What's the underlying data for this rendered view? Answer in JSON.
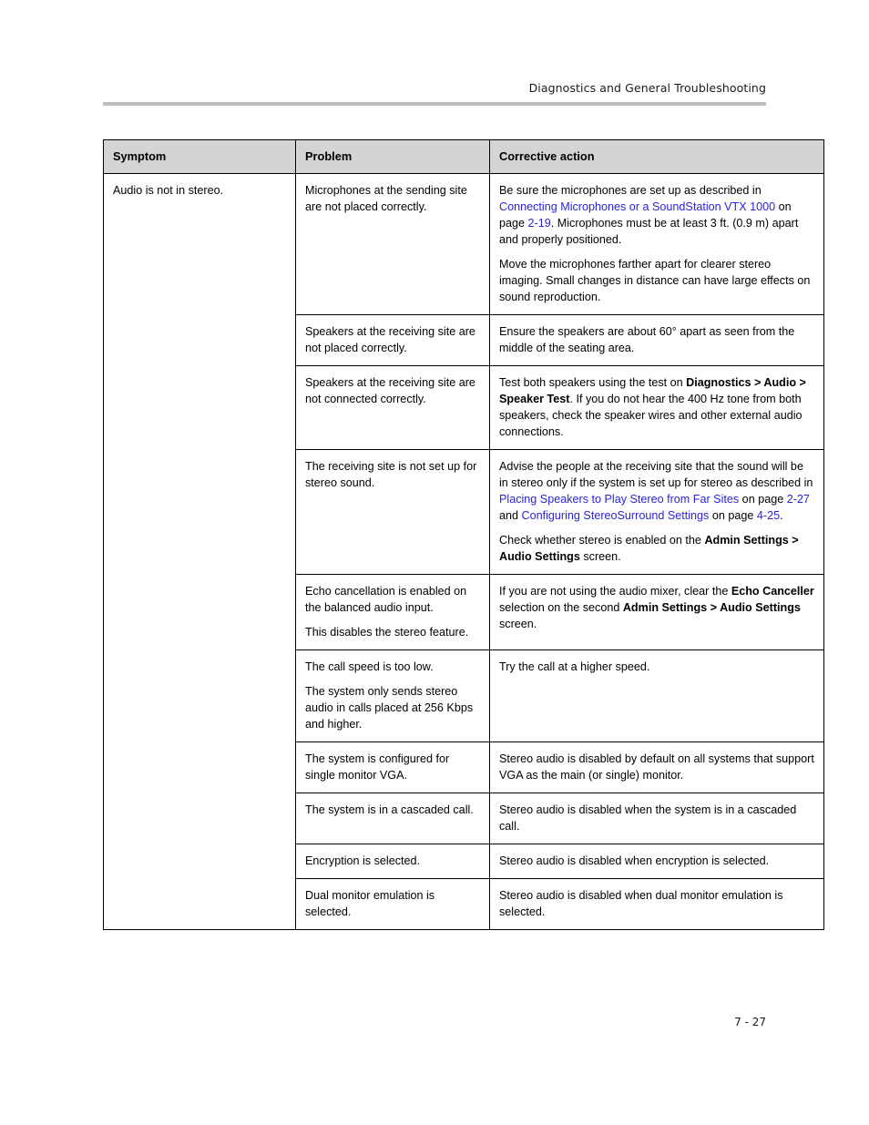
{
  "header": {
    "title": "Diagnostics and General Troubleshooting"
  },
  "footer": {
    "page_number": "7 - 27"
  },
  "colors": {
    "link": "#2a24d6",
    "header_row_background": "#d4d4d4",
    "header_rule": "#bfbfbf",
    "border": "#000000",
    "text": "#000000"
  },
  "table": {
    "columns": [
      "Symptom",
      "Problem",
      "Corrective action"
    ],
    "symptom": "Audio is not in stereo.",
    "rows": [
      {
        "problem": [
          "Microphones at the sending site are not placed correctly."
        ],
        "action": [
          {
            "runs": [
              {
                "text": "Be sure the microphones are set up as described in ",
                "style": "normal"
              },
              {
                "text": "Connecting Microphones or a SoundStation VTX 1000",
                "style": "link"
              },
              {
                "text": " on page ",
                "style": "normal"
              },
              {
                "text": "2-19",
                "style": "link"
              },
              {
                "text": ". Microphones must be at least 3 ft. (0.9 m) apart and properly positioned.",
                "style": "normal"
              }
            ]
          },
          {
            "runs": [
              {
                "text": "Move the microphones farther apart for clearer stereo imaging. Small changes in distance can have large effects on sound reproduction.",
                "style": "normal"
              }
            ]
          }
        ]
      },
      {
        "problem": [
          "Speakers at the receiving site are not placed correctly."
        ],
        "action": [
          {
            "runs": [
              {
                "text": "Ensure the speakers are about 60° apart as seen from the middle of the seating area.",
                "style": "normal"
              }
            ]
          }
        ]
      },
      {
        "problem": [
          "Speakers at the receiving site are not connected correctly."
        ],
        "action": [
          {
            "runs": [
              {
                "text": "Test both speakers using the test on ",
                "style": "normal"
              },
              {
                "text": "Diagnostics > Audio > Speaker Test",
                "style": "bold"
              },
              {
                "text": ". If you do not hear the 400 Hz tone from both speakers, check the speaker wires and other external audio connections.",
                "style": "normal"
              }
            ]
          }
        ]
      },
      {
        "problem": [
          "The receiving site is not set up for stereo sound."
        ],
        "action": [
          {
            "runs": [
              {
                "text": "Advise the people at the receiving site that the sound will be in stereo only if the system is set up for stereo as described in ",
                "style": "normal"
              },
              {
                "text": "Placing Speakers to Play Stereo from Far Sites",
                "style": "link"
              },
              {
                "text": " on page ",
                "style": "normal"
              },
              {
                "text": "2-27",
                "style": "link"
              },
              {
                "text": " and ",
                "style": "normal"
              },
              {
                "text": "Configuring StereoSurround Settings",
                "style": "link"
              },
              {
                "text": " on page ",
                "style": "normal"
              },
              {
                "text": "4-25",
                "style": "link"
              },
              {
                "text": ".",
                "style": "normal"
              }
            ]
          },
          {
            "runs": [
              {
                "text": "Check whether stereo is enabled on the ",
                "style": "normal"
              },
              {
                "text": "Admin Settings > Audio Settings",
                "style": "bold"
              },
              {
                "text": " screen.",
                "style": "normal"
              }
            ]
          }
        ]
      },
      {
        "problem": [
          "Echo cancellation is enabled on the balanced audio input.",
          "This disables the stereo feature."
        ],
        "action": [
          {
            "runs": [
              {
                "text": "If you are not using the audio mixer, clear the ",
                "style": "normal"
              },
              {
                "text": "Echo Canceller",
                "style": "bold"
              },
              {
                "text": " selection on the second ",
                "style": "normal"
              },
              {
                "text": "Admin Settings > Audio Settings",
                "style": "bold"
              },
              {
                "text": " screen.",
                "style": "normal"
              }
            ]
          }
        ]
      },
      {
        "problem": [
          "The call speed is too low.",
          "The system only sends stereo audio in calls placed at 256 Kbps and higher."
        ],
        "action": [
          {
            "runs": [
              {
                "text": "Try the call at a higher speed.",
                "style": "normal"
              }
            ]
          }
        ]
      },
      {
        "problem": [
          "The system is configured for single monitor VGA."
        ],
        "action": [
          {
            "runs": [
              {
                "text": "Stereo audio is disabled by default on all systems that support VGA as the main (or single) monitor.",
                "style": "normal"
              }
            ]
          }
        ]
      },
      {
        "problem": [
          "The system is in a cascaded call."
        ],
        "action": [
          {
            "runs": [
              {
                "text": "Stereo audio is disabled when the system is in a cascaded call.",
                "style": "normal"
              }
            ]
          }
        ]
      },
      {
        "problem": [
          "Encryption is selected."
        ],
        "action": [
          {
            "runs": [
              {
                "text": "Stereo audio is disabled when encryption is selected.",
                "style": "normal"
              }
            ]
          }
        ]
      },
      {
        "problem": [
          "Dual monitor emulation is selected."
        ],
        "action": [
          {
            "runs": [
              {
                "text": "Stereo audio is disabled when dual monitor emulation is selected.",
                "style": "normal"
              }
            ]
          }
        ]
      }
    ]
  }
}
